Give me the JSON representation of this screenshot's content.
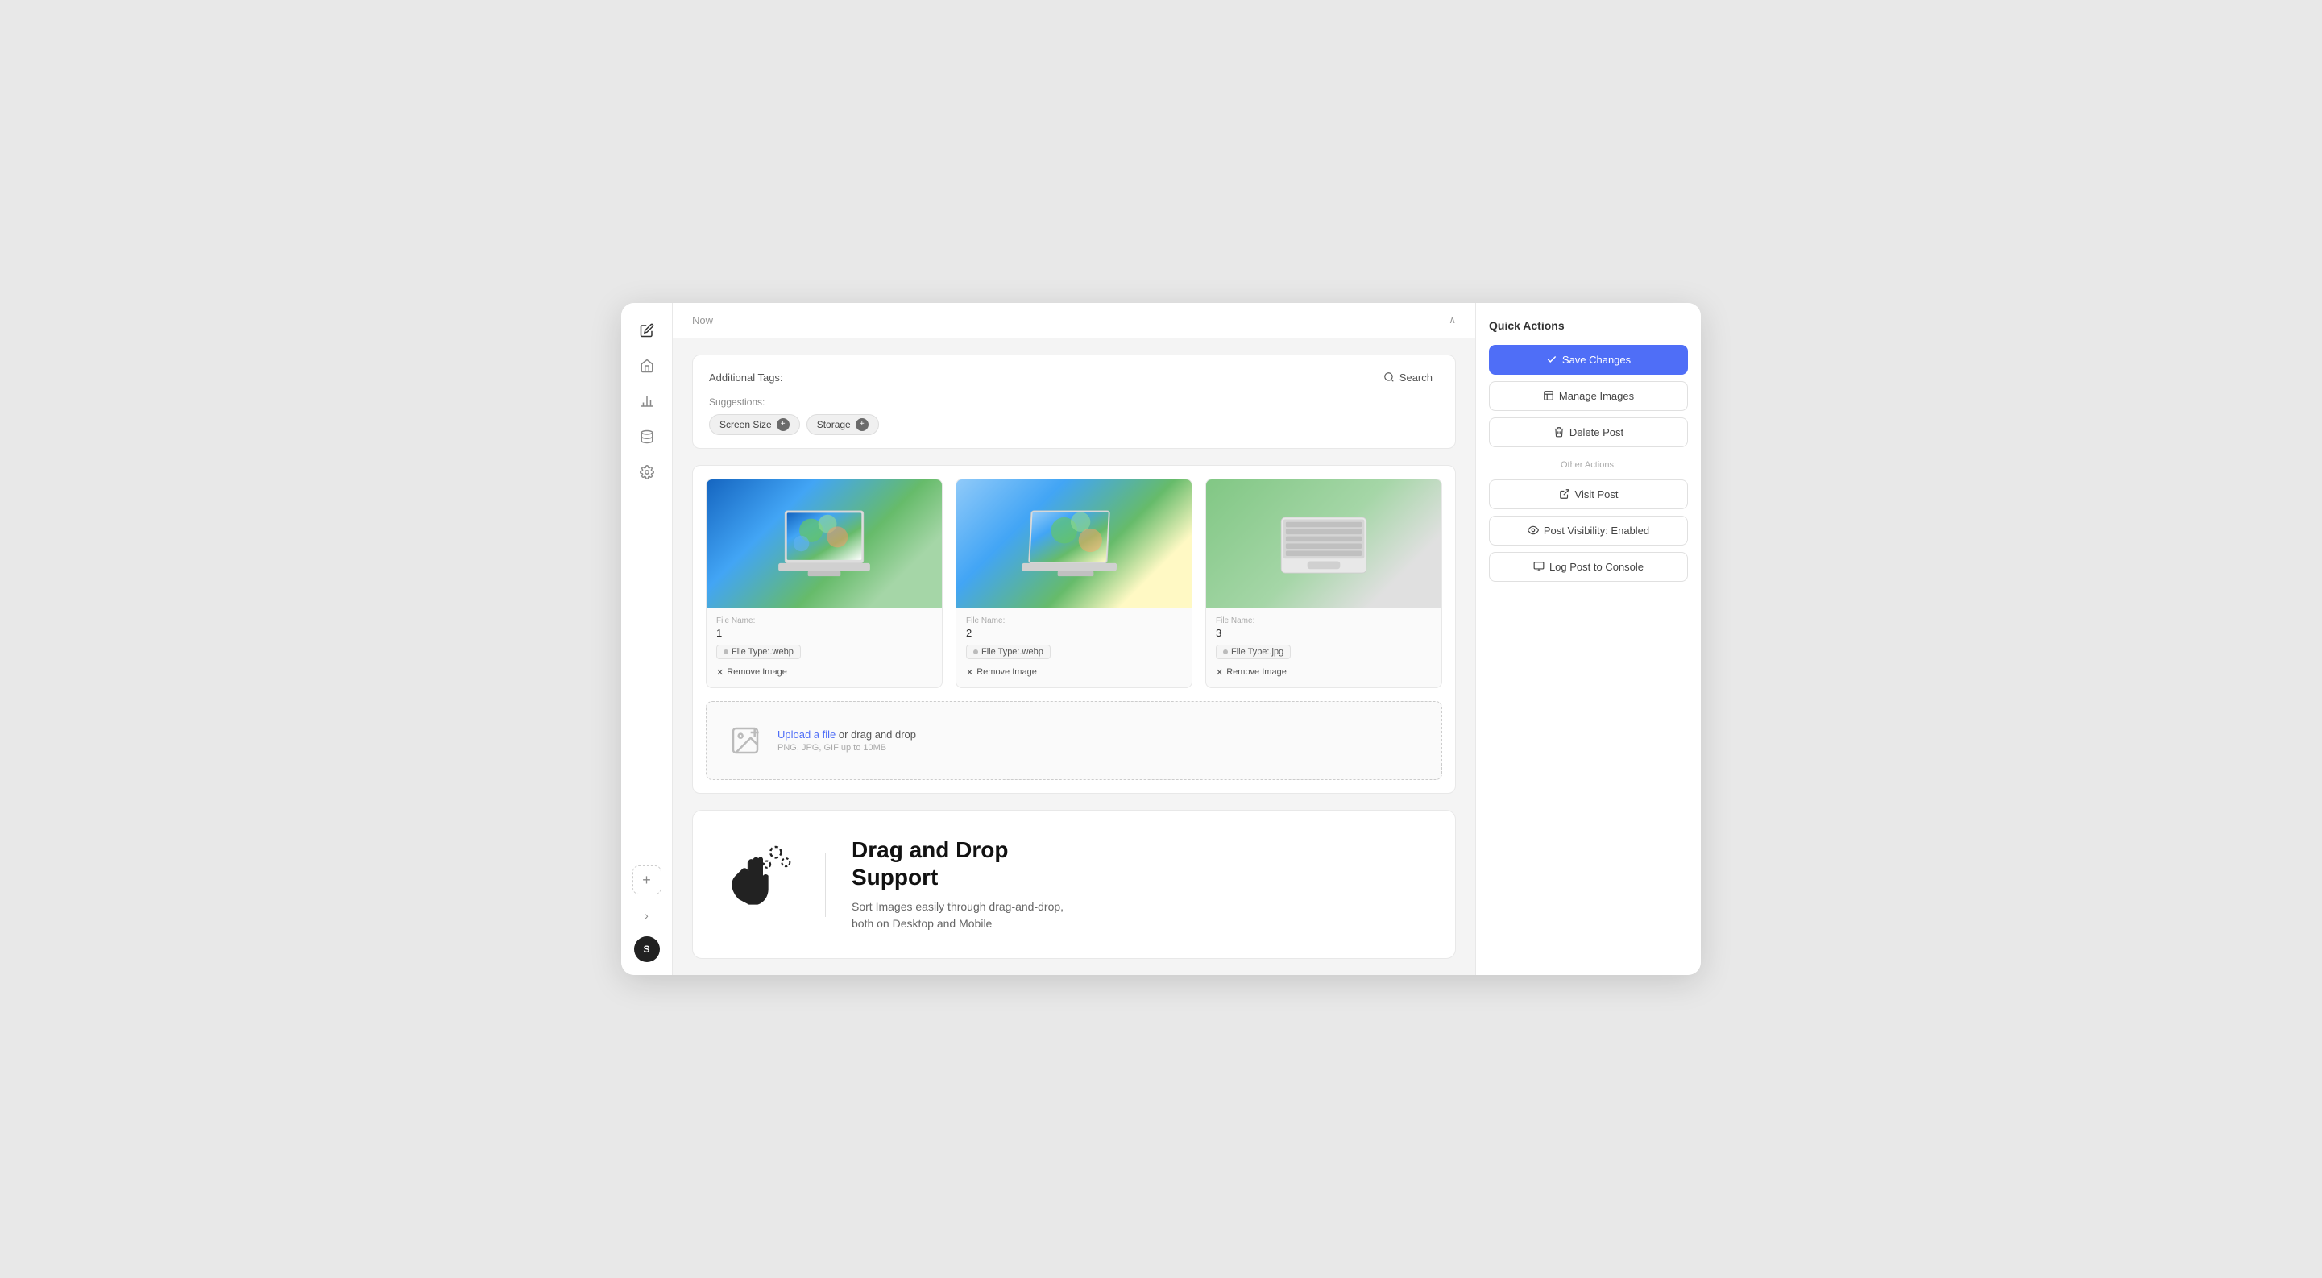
{
  "sidebar": {
    "icons": [
      {
        "name": "pen-icon",
        "symbol": "✏️"
      },
      {
        "name": "home-icon",
        "symbol": "🏠"
      },
      {
        "name": "chart-icon",
        "symbol": "📊"
      },
      {
        "name": "database-icon",
        "symbol": "🗄️"
      },
      {
        "name": "gear-icon",
        "symbol": "⚙️"
      }
    ],
    "add_label": "+",
    "chevron_label": "›",
    "avatar_label": "S"
  },
  "collapse_bar": {
    "text": "Now",
    "chevron": "∧"
  },
  "tags_section": {
    "title": "Additional Tags:",
    "search_button": "Search",
    "suggestions_label": "Suggestions:",
    "chips": [
      {
        "label": "Screen Size"
      },
      {
        "label": "Storage"
      }
    ]
  },
  "images_section": {
    "images": [
      {
        "file_name_label": "File Name:",
        "file_name": "1",
        "file_type_label": "File Type:",
        "file_type": ".webp",
        "remove_label": "Remove Image"
      },
      {
        "file_name_label": "File Name:",
        "file_name": "2",
        "file_type_label": "File Type:",
        "file_type": ".webp",
        "remove_label": "Remove Image"
      },
      {
        "file_name_label": "File Name:",
        "file_name": "3",
        "file_type_label": "File Type:",
        "file_type": ".jpg",
        "remove_label": "Remove Image"
      }
    ]
  },
  "upload": {
    "link_text": "Upload a file",
    "suffix_text": " or drag and drop",
    "hint": "PNG, JPG, GIF up to 10MB"
  },
  "drag_drop": {
    "title": "Drag and Drop\nSupport",
    "description": "Sort Images easily through drag-and-drop,\nboth on Desktop and Mobile"
  },
  "quick_actions": {
    "title": "Quick Actions",
    "save_button": "Save Changes",
    "manage_button": "Manage Images",
    "delete_button": "Delete Post",
    "other_label": "Other Actions:",
    "visit_button": "Visit Post",
    "visibility_button": "Post Visibility: Enabled",
    "log_button": "Log Post to Console"
  }
}
